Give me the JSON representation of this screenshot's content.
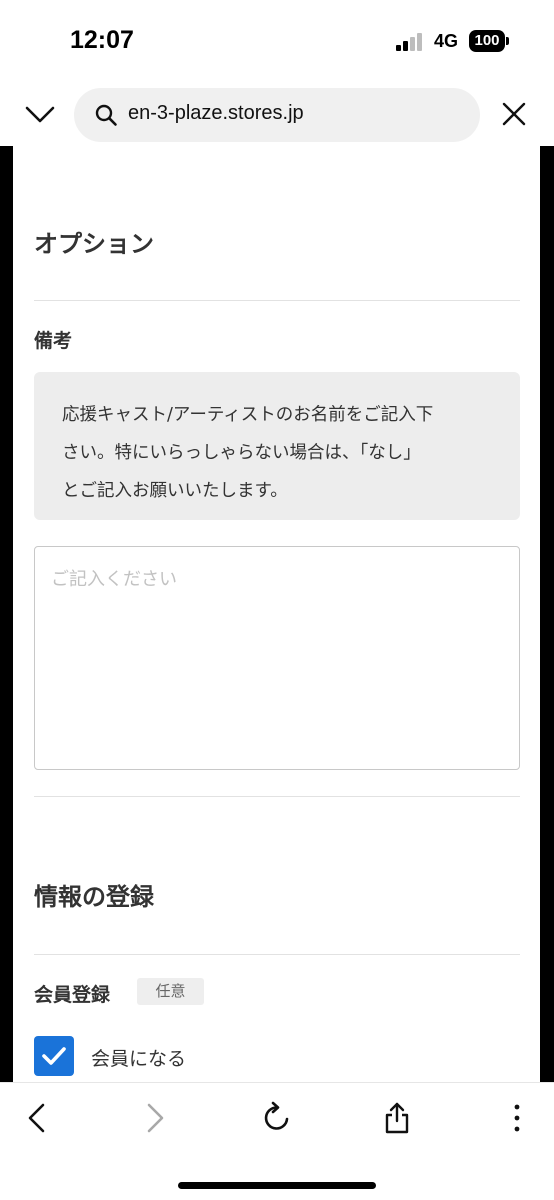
{
  "status_bar": {
    "time": "12:07",
    "network": "4G",
    "battery": "100"
  },
  "browser": {
    "url": "en-3-plaze.stores.jp"
  },
  "options": {
    "title": "オプション",
    "remarks_label": "備考",
    "note_lines": [
      "応援キャスト/アーティストのお名前をご記入下",
      "さい。特にいらっしゃらない場合は、「なし」",
      "とご記入お願いいたします。"
    ],
    "textarea_placeholder": "ご記入ください"
  },
  "registration": {
    "title": "情報の登録",
    "member_label": "会員登録",
    "optional_badge": "任意",
    "checkbox_label": "会員になる",
    "checkbox_checked": true
  },
  "colors": {
    "accent": "#1a73d9",
    "note_bg": "#ededed"
  },
  "icons": [
    "chevron-down-icon",
    "search-icon",
    "close-icon",
    "back-icon",
    "forward-icon",
    "reload-icon",
    "share-icon",
    "more-icon",
    "check-icon"
  ]
}
